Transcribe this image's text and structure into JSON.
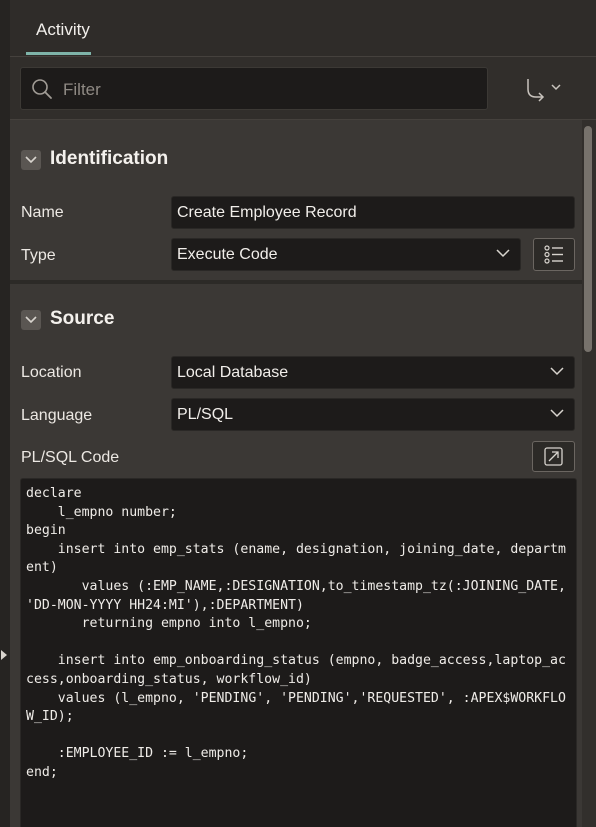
{
  "tabs": [
    {
      "label": "Activity",
      "active": true
    }
  ],
  "toolbar": {
    "filter_placeholder": "Filter"
  },
  "sections": {
    "identification": {
      "title": "Identification",
      "name_label": "Name",
      "name_value": "Create Employee Record",
      "type_label": "Type",
      "type_value": "Execute Code"
    },
    "source": {
      "title": "Source",
      "location_label": "Location",
      "location_value": "Local Database",
      "language_label": "Language",
      "language_value": "PL/SQL",
      "code_label": "PL/SQL Code",
      "code": "declare\n    l_empno number;\nbegin\n    insert into emp_stats (ename, designation, joining_date, department)\n       values (:EMP_NAME,:DESIGNATION,to_timestamp_tz(:JOINING_DATE, 'DD-MON-YYYY HH24:MI'),:DEPARTMENT)\n       returning empno into l_empno;\n\n    insert into emp_onboarding_status (empno, badge_access,laptop_access,onboarding_status, workflow_id)\n    values (l_empno, 'PENDING', 'PENDING','REQUESTED', :APEX$WORKFLOW_ID);\n\n    :EMPLOYEE_ID := l_empno;\nend;"
    }
  },
  "colors": {
    "accent": "#7fb4a9",
    "field_bg": "#1d1b1a",
    "panel_bg": "#3b3835"
  },
  "icons": [
    "search-icon",
    "goto-arrow-icon",
    "chevron-down-icon",
    "collapse-chevron-icon",
    "list-icon",
    "expand-editor-icon",
    "panel-collapse-arrow-icon"
  ]
}
